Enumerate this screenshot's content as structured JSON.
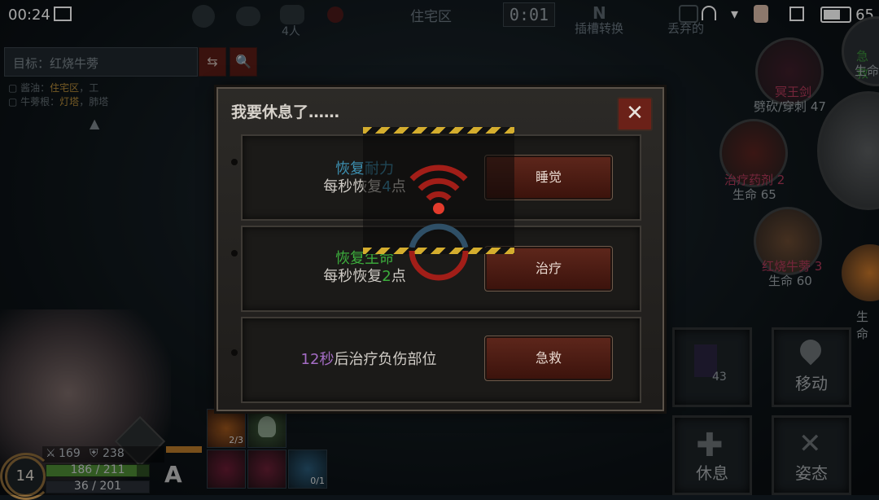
{
  "status_bar": {
    "time": "00:24",
    "battery": "65"
  },
  "hud_top": {
    "area": "住宅区",
    "players": "4人",
    "timer": "0:01",
    "swap_label": "插槽转换",
    "discard_label": "丢弃的"
  },
  "quest": {
    "target": "目标：红烧牛蒡",
    "lines": [
      {
        "label": "酱油：",
        "place": "住宅区",
        "extra": "，工"
      },
      {
        "label": "牛蒡根：",
        "place": "灯塔",
        "extra": "，肺塔"
      }
    ]
  },
  "dialog": {
    "title": "我要休息了……",
    "close": "✕",
    "rows": [
      {
        "title": "恢复耐力",
        "title_color": "#3c8fb0",
        "sub_pre": "每秒恢复",
        "sub_num": "4",
        "sub_post": "点",
        "num_color": "#3c8fb0",
        "button": "睡觉"
      },
      {
        "title": "恢复生命",
        "title_color": "#3cae3c",
        "sub_pre": "每秒恢复",
        "sub_num": "2",
        "sub_post": "点",
        "num_color": "#3cae3c",
        "button": "治疗"
      },
      {
        "title_num": "12秒",
        "title_rest": "后治疗负伤部位",
        "num_color": "#a46cc4",
        "button": "急救"
      }
    ]
  },
  "player": {
    "level": "14",
    "attack": "169",
    "defense": "238",
    "hp": "186 / 211",
    "hp_fraction": 0.88,
    "stamina": "36 / 201",
    "grade": "A"
  },
  "skills": [
    {
      "count": "2/3"
    },
    {
      "count": ""
    },
    {
      "count": ""
    },
    {
      "count": ""
    },
    {
      "count": "0/1"
    }
  ],
  "right_panel": {
    "weapon": {
      "name": "冥王剑",
      "type": "劈砍/穿刺 47"
    },
    "item1": {
      "name": "治疗药剂 2",
      "hp": "生命 65"
    },
    "item2": {
      "name": "红烧牛蒡 3",
      "hp": "生命 60"
    },
    "rescue": {
      "name": "急救",
      "hp": "生命"
    },
    "extra": {
      "hp": "生命"
    },
    "buttons": {
      "slot_count": "43",
      "move": "移动",
      "rest": "休息",
      "stance": "姿态"
    }
  }
}
